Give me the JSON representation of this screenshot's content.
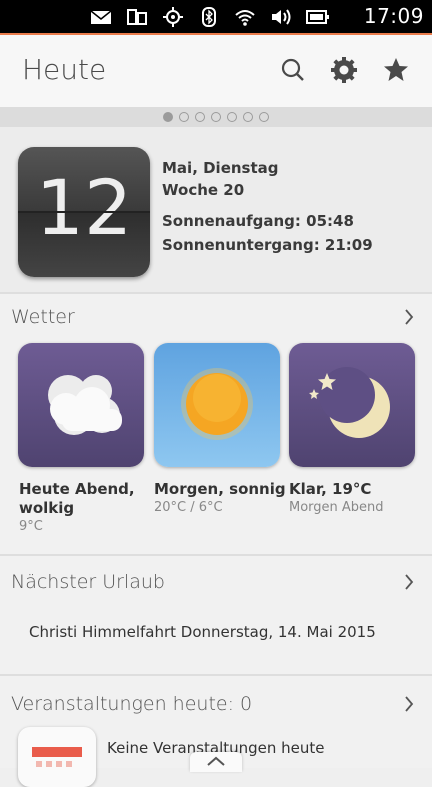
{
  "status_bar": {
    "time": "17:09",
    "icons": [
      "mail-icon",
      "transfer-icon",
      "location-icon",
      "bluetooth-icon",
      "wifi-icon",
      "volume-icon",
      "battery-icon"
    ]
  },
  "header": {
    "title": "Heute",
    "actions": [
      "search-icon",
      "gear-icon",
      "star-icon"
    ]
  },
  "pager": {
    "count": 7,
    "active_index": 0
  },
  "date_card": {
    "day_number": "12",
    "line1": "Mai, Dienstag",
    "line2": "Woche 20",
    "sunrise": "Sonnenaufgang: 05:48",
    "sunset": "Sonnenuntergang: 21:09"
  },
  "weather": {
    "title": "Wetter",
    "tiles": [
      {
        "icon": "cloud-icon",
        "label": "Heute Abend, wolkig",
        "sub": "9°C"
      },
      {
        "icon": "sun-icon",
        "label": "Morgen, sonnig",
        "sub": "20°C / 6°C"
      },
      {
        "icon": "moon-icon",
        "label": "Klar, 19°C",
        "sub": "Morgen Abend"
      }
    ]
  },
  "vacation": {
    "title": "Nächster Urlaub",
    "entry": "Christi Himmelfahrt Donnerstag, 14. Mai 2015"
  },
  "events": {
    "title": "Veranstaltungen heute: 0",
    "entry": "Keine Veranstaltungen heute"
  },
  "colors": {
    "accent": "#e9672f",
    "weather_tile": "#5e4f84",
    "sun_tile": "#72b5ea",
    "sun": "#f5a623"
  }
}
